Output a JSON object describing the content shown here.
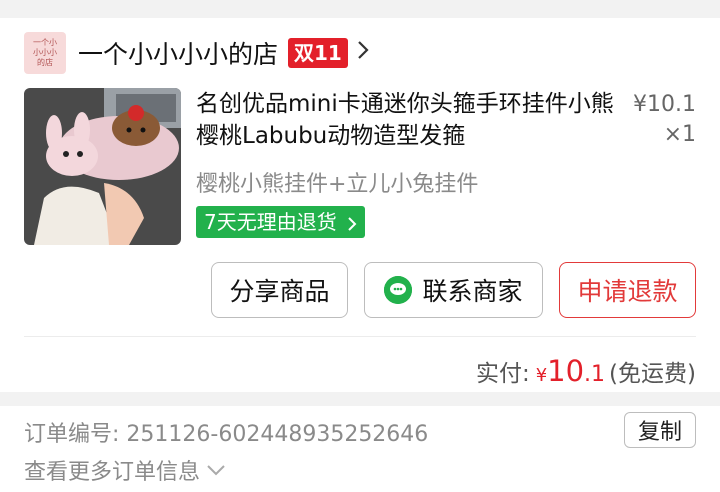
{
  "shop": {
    "logo_text": [
      "一个小",
      "小小小",
      "的店"
    ],
    "name": "一个小小小小的店",
    "badge": "双11",
    "chevron_icon": "chevron-right-icon"
  },
  "item": {
    "image": "product-photo-bear-bunny-headband",
    "title": "名创优品mini卡通迷你头箍手环挂件小熊樱桃Labubu动物造型发箍",
    "price": "¥10.1",
    "quantity": "×1",
    "variant": "樱桃小熊挂件+立儿小兔挂件",
    "return_policy": "7天无理由退货"
  },
  "actions": {
    "share": "分享商品",
    "contact": "联系商家",
    "contact_icon": "wechat-chat-icon",
    "refund": "申请退款"
  },
  "payment": {
    "label": "实付:",
    "currency": "¥",
    "amount_int": "10",
    "amount_dec": ".1",
    "note": "(免运费)"
  },
  "order": {
    "number_label": "订单编号:",
    "number": "251126-602448935252646",
    "copy": "复制",
    "more": "查看更多订单信息"
  },
  "colors": {
    "accent_red": "#e3202a",
    "return_green": "#22b14c"
  }
}
